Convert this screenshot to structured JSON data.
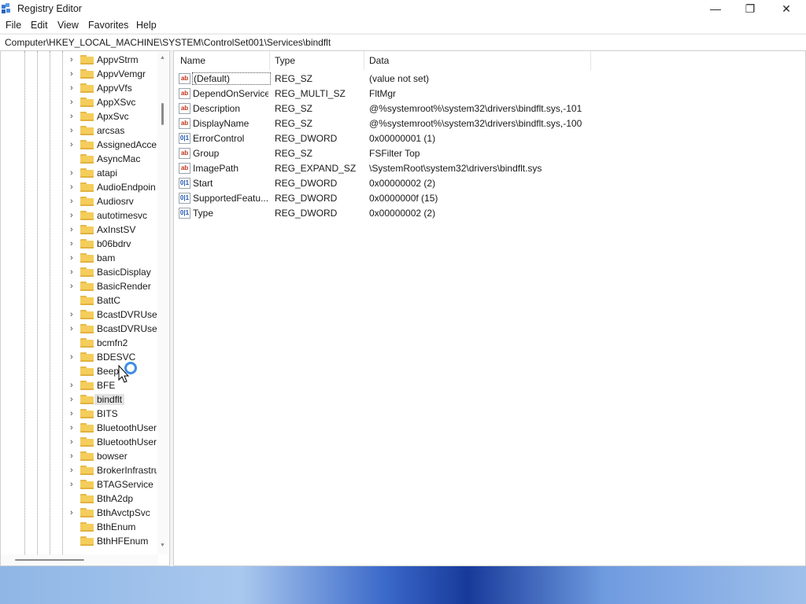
{
  "window": {
    "title": "Registry Editor",
    "controls": {
      "minimize": "—",
      "maximize": "❐",
      "close": "✕"
    }
  },
  "menu": [
    "File",
    "Edit",
    "View",
    "Favorites",
    "Help"
  ],
  "address": "Computer\\HKEY_LOCAL_MACHINE\\SYSTEM\\ControlSet001\\Services\\bindflt",
  "tree": {
    "items": [
      {
        "label": "AppvStrm",
        "expandable": true
      },
      {
        "label": "AppvVemgr",
        "expandable": true
      },
      {
        "label": "AppvVfs",
        "expandable": true
      },
      {
        "label": "AppXSvc",
        "expandable": true
      },
      {
        "label": "ApxSvc",
        "expandable": true
      },
      {
        "label": "arcsas",
        "expandable": true
      },
      {
        "label": "AssignedAcce",
        "expandable": true
      },
      {
        "label": "AsyncMac",
        "expandable": false
      },
      {
        "label": "atapi",
        "expandable": true
      },
      {
        "label": "AudioEndpoin",
        "expandable": true
      },
      {
        "label": "Audiosrv",
        "expandable": true
      },
      {
        "label": "autotimesvc",
        "expandable": true
      },
      {
        "label": "AxInstSV",
        "expandable": true
      },
      {
        "label": "b06bdrv",
        "expandable": true
      },
      {
        "label": "bam",
        "expandable": true
      },
      {
        "label": "BasicDisplay",
        "expandable": true
      },
      {
        "label": "BasicRender",
        "expandable": true
      },
      {
        "label": "BattC",
        "expandable": false
      },
      {
        "label": "BcastDVRUser!",
        "expandable": true
      },
      {
        "label": "BcastDVRUser!",
        "expandable": true
      },
      {
        "label": "bcmfn2",
        "expandable": false
      },
      {
        "label": "BDESVC",
        "expandable": true
      },
      {
        "label": "Beep",
        "expandable": false
      },
      {
        "label": "BFE",
        "expandable": true
      },
      {
        "label": "bindflt",
        "expandable": true,
        "selected": true
      },
      {
        "label": "BITS",
        "expandable": true
      },
      {
        "label": "BluetoothUser",
        "expandable": true
      },
      {
        "label": "BluetoothUser",
        "expandable": true
      },
      {
        "label": "bowser",
        "expandable": true
      },
      {
        "label": "BrokerInfrastru",
        "expandable": true
      },
      {
        "label": "BTAGService",
        "expandable": true
      },
      {
        "label": "BthA2dp",
        "expandable": false
      },
      {
        "label": "BthAvctpSvc",
        "expandable": true
      },
      {
        "label": "BthEnum",
        "expandable": false
      },
      {
        "label": "BthHFEnum",
        "expandable": false
      }
    ]
  },
  "list": {
    "columns": [
      "Name",
      "Type",
      "Data"
    ],
    "rows": [
      {
        "name": "(Default)",
        "type": "REG_SZ",
        "data": "(value not set)",
        "icon": "string-value-icon",
        "kind": "sz"
      },
      {
        "name": "DependOnService",
        "type": "REG_MULTI_SZ",
        "data": "FltMgr",
        "icon": "string-value-icon",
        "kind": "sz"
      },
      {
        "name": "Description",
        "type": "REG_SZ",
        "data": "@%systemroot%\\system32\\drivers\\bindflt.sys,-101",
        "icon": "string-value-icon",
        "kind": "sz"
      },
      {
        "name": "DisplayName",
        "type": "REG_SZ",
        "data": "@%systemroot%\\system32\\drivers\\bindflt.sys,-100",
        "icon": "string-value-icon",
        "kind": "sz"
      },
      {
        "name": "ErrorControl",
        "type": "REG_DWORD",
        "data": "0x00000001 (1)",
        "icon": "binary-value-icon",
        "kind": "dword"
      },
      {
        "name": "Group",
        "type": "REG_SZ",
        "data": "FSFilter Top",
        "icon": "string-value-icon",
        "kind": "sz"
      },
      {
        "name": "ImagePath",
        "type": "REG_EXPAND_SZ",
        "data": "\\SystemRoot\\system32\\drivers\\bindflt.sys",
        "icon": "string-value-icon",
        "kind": "sz"
      },
      {
        "name": "Start",
        "type": "REG_DWORD",
        "data": "0x00000002 (2)",
        "icon": "binary-value-icon",
        "kind": "dword"
      },
      {
        "name": "SupportedFeatu...",
        "type": "REG_DWORD",
        "data": "0x0000000f (15)",
        "icon": "binary-value-icon",
        "kind": "dword"
      },
      {
        "name": "Type",
        "type": "REG_DWORD",
        "data": "0x00000002 (2)",
        "icon": "binary-value-icon",
        "kind": "dword"
      }
    ]
  },
  "icons": {
    "sz": "ab",
    "dword": "011\n110"
  },
  "colors": {
    "folder": "#f4cd5b",
    "selection": "#e3e3e3",
    "busy_ring": "#3d8ee6"
  }
}
